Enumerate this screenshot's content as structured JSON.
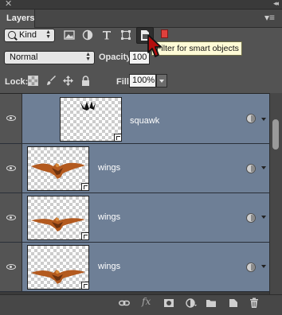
{
  "panel": {
    "tab_label": "Layers"
  },
  "filter": {
    "kind_label": "Kind",
    "tooltip": "Filter for smart objects",
    "toggle_color": "#e0403c"
  },
  "blend": {
    "mode": "Normal",
    "opacity_label": "Opacity:",
    "opacity_value": "100"
  },
  "lock": {
    "label": "Lock:",
    "fill_label": "Fill:",
    "fill_value": "100%"
  },
  "layers": [
    {
      "name": "squawk",
      "type": "smart-object"
    },
    {
      "name": "wings",
      "type": "smart-object"
    },
    {
      "name": "wings",
      "type": "smart-object"
    },
    {
      "name": "wings",
      "type": "smart-object"
    }
  ],
  "colors": {
    "selected_row": "#6e7f96",
    "panel_bg": "#535353"
  }
}
